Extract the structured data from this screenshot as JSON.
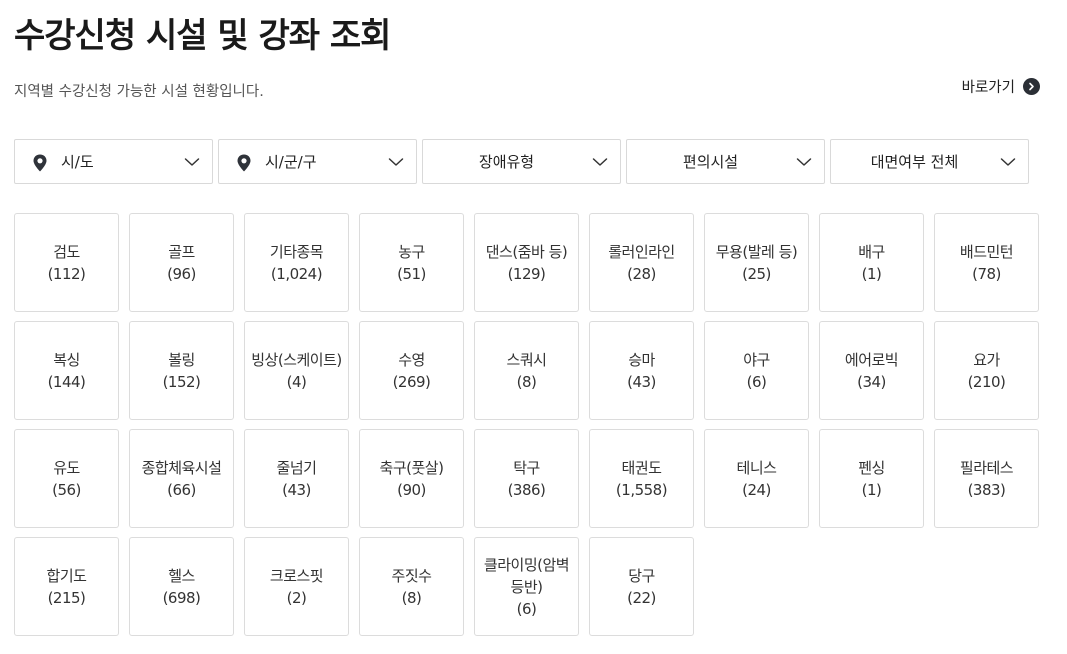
{
  "header": {
    "title": "수강신청 시설 및 강좌 조회",
    "subtitle": "지역별 수강신청 가능한 시설 현황입니다.",
    "shortcut_label": "바로가기"
  },
  "filters": [
    {
      "label": "시/도",
      "icon": "location-pin-icon"
    },
    {
      "label": "시/군/구",
      "icon": "location-pin-icon"
    },
    {
      "label": "장애유형"
    },
    {
      "label": "편의시설"
    },
    {
      "label": "대면여부 전체"
    }
  ],
  "categories": [
    {
      "name": "검도",
      "count": "(112)"
    },
    {
      "name": "골프",
      "count": "(96)"
    },
    {
      "name": "기타종목",
      "count": "(1,024)"
    },
    {
      "name": "농구",
      "count": "(51)"
    },
    {
      "name": "댄스(줌바 등)",
      "count": "(129)"
    },
    {
      "name": "롤러인라인",
      "count": "(28)"
    },
    {
      "name": "무용(발레 등)",
      "count": "(25)"
    },
    {
      "name": "배구",
      "count": "(1)"
    },
    {
      "name": "배드민턴",
      "count": "(78)"
    },
    {
      "name": "복싱",
      "count": "(144)"
    },
    {
      "name": "볼링",
      "count": "(152)"
    },
    {
      "name": "빙상(스케이트)",
      "count": "(4)"
    },
    {
      "name": "수영",
      "count": "(269)"
    },
    {
      "name": "스쿼시",
      "count": "(8)"
    },
    {
      "name": "승마",
      "count": "(43)"
    },
    {
      "name": "야구",
      "count": "(6)"
    },
    {
      "name": "에어로빅",
      "count": "(34)"
    },
    {
      "name": "요가",
      "count": "(210)"
    },
    {
      "name": "유도",
      "count": "(56)"
    },
    {
      "name": "종합체육시설",
      "count": "(66)"
    },
    {
      "name": "줄넘기",
      "count": "(43)"
    },
    {
      "name": "축구(풋살)",
      "count": "(90)"
    },
    {
      "name": "탁구",
      "count": "(386)"
    },
    {
      "name": "태권도",
      "count": "(1,558)"
    },
    {
      "name": "테니스",
      "count": "(24)"
    },
    {
      "name": "펜싱",
      "count": "(1)"
    },
    {
      "name": "필라테스",
      "count": "(383)"
    },
    {
      "name": "합기도",
      "count": "(215)"
    },
    {
      "name": "헬스",
      "count": "(698)"
    },
    {
      "name": "크로스핏",
      "count": "(2)"
    },
    {
      "name": "주짓수",
      "count": "(8)"
    },
    {
      "name": "클라이밍(암벽등반)",
      "count": "(6)"
    },
    {
      "name": "당구",
      "count": "(22)"
    }
  ],
  "colors": {
    "text": "#222222",
    "border": "#dcdcdc",
    "shortcut_icon_bg": "#2b2f36"
  }
}
